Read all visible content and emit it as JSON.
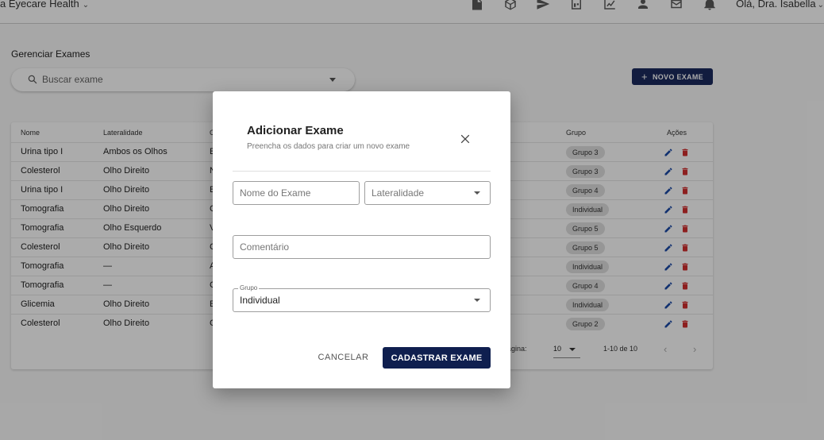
{
  "header": {
    "brand": "a Eyecare Health",
    "greeting": "Olá, Dra. Isabella",
    "icons": [
      "document-icon",
      "box-icon",
      "send-icon",
      "dashboard-icon",
      "chart-icon",
      "person-icon",
      "mail-icon",
      "bell-icon"
    ]
  },
  "page": {
    "title": "Gerenciar Exames",
    "search_placeholder": "Buscar exame",
    "new_button": "NOVO EXAME"
  },
  "table": {
    "headers": {
      "nome": "Nome",
      "lateralidade": "Lateralidade",
      "c": "C",
      "grupo": "Grupo",
      "acoes": "Ações"
    },
    "rows": [
      {
        "nome": "Urina tipo I",
        "lateralidade": "Ambos os Olhos",
        "c": "E",
        "grupo": "Grupo 3"
      },
      {
        "nome": "Colesterol",
        "lateralidade": "Olho Direito",
        "c": "N",
        "grupo": "Grupo 3"
      },
      {
        "nome": "Urina tipo I",
        "lateralidade": "Olho Direito",
        "c": "E",
        "grupo": "Grupo 4"
      },
      {
        "nome": "Tomografia",
        "lateralidade": "Olho Direito",
        "c": "C",
        "grupo": "Individual"
      },
      {
        "nome": "Tomografia",
        "lateralidade": "Olho Esquerdo",
        "c": "V",
        "grupo": "Grupo 5"
      },
      {
        "nome": "Colesterol",
        "lateralidade": "Olho Direito",
        "c": "C",
        "grupo": "Grupo 5"
      },
      {
        "nome": "Tomografia",
        "lateralidade": "—",
        "c": "A",
        "grupo": "Individual"
      },
      {
        "nome": "Tomografia",
        "lateralidade": "—",
        "c": "C",
        "grupo": "Grupo 4"
      },
      {
        "nome": "Glicemia",
        "lateralidade": "Olho Direito",
        "c": "E",
        "grupo": "Individual"
      },
      {
        "nome": "Colesterol",
        "lateralidade": "Olho Direito",
        "c": "C",
        "grupo": "Grupo 2"
      }
    ],
    "pagination": {
      "rows_label": "página:",
      "rows_per_page": "10",
      "range": "1-10 de 10",
      "prev": "‹",
      "next": "›"
    }
  },
  "modal": {
    "title": "Adicionar Exame",
    "subtitle": "Preencha os dados para criar um novo exame",
    "name_placeholder": "Nome do Exame",
    "laterality_placeholder": "Lateralidade",
    "comment_placeholder": "Comentário",
    "group_label": "Grupo",
    "group_value": "Individual",
    "cancel_label": "CANCELAR",
    "submit_label": "CADASTRAR EXAME"
  },
  "colors": {
    "primary": "#1b2a5e",
    "submit": "#0f1f4f",
    "edit": "#1b4aa8",
    "delete": "#d32f2f",
    "chip": "#e0e0e0"
  }
}
